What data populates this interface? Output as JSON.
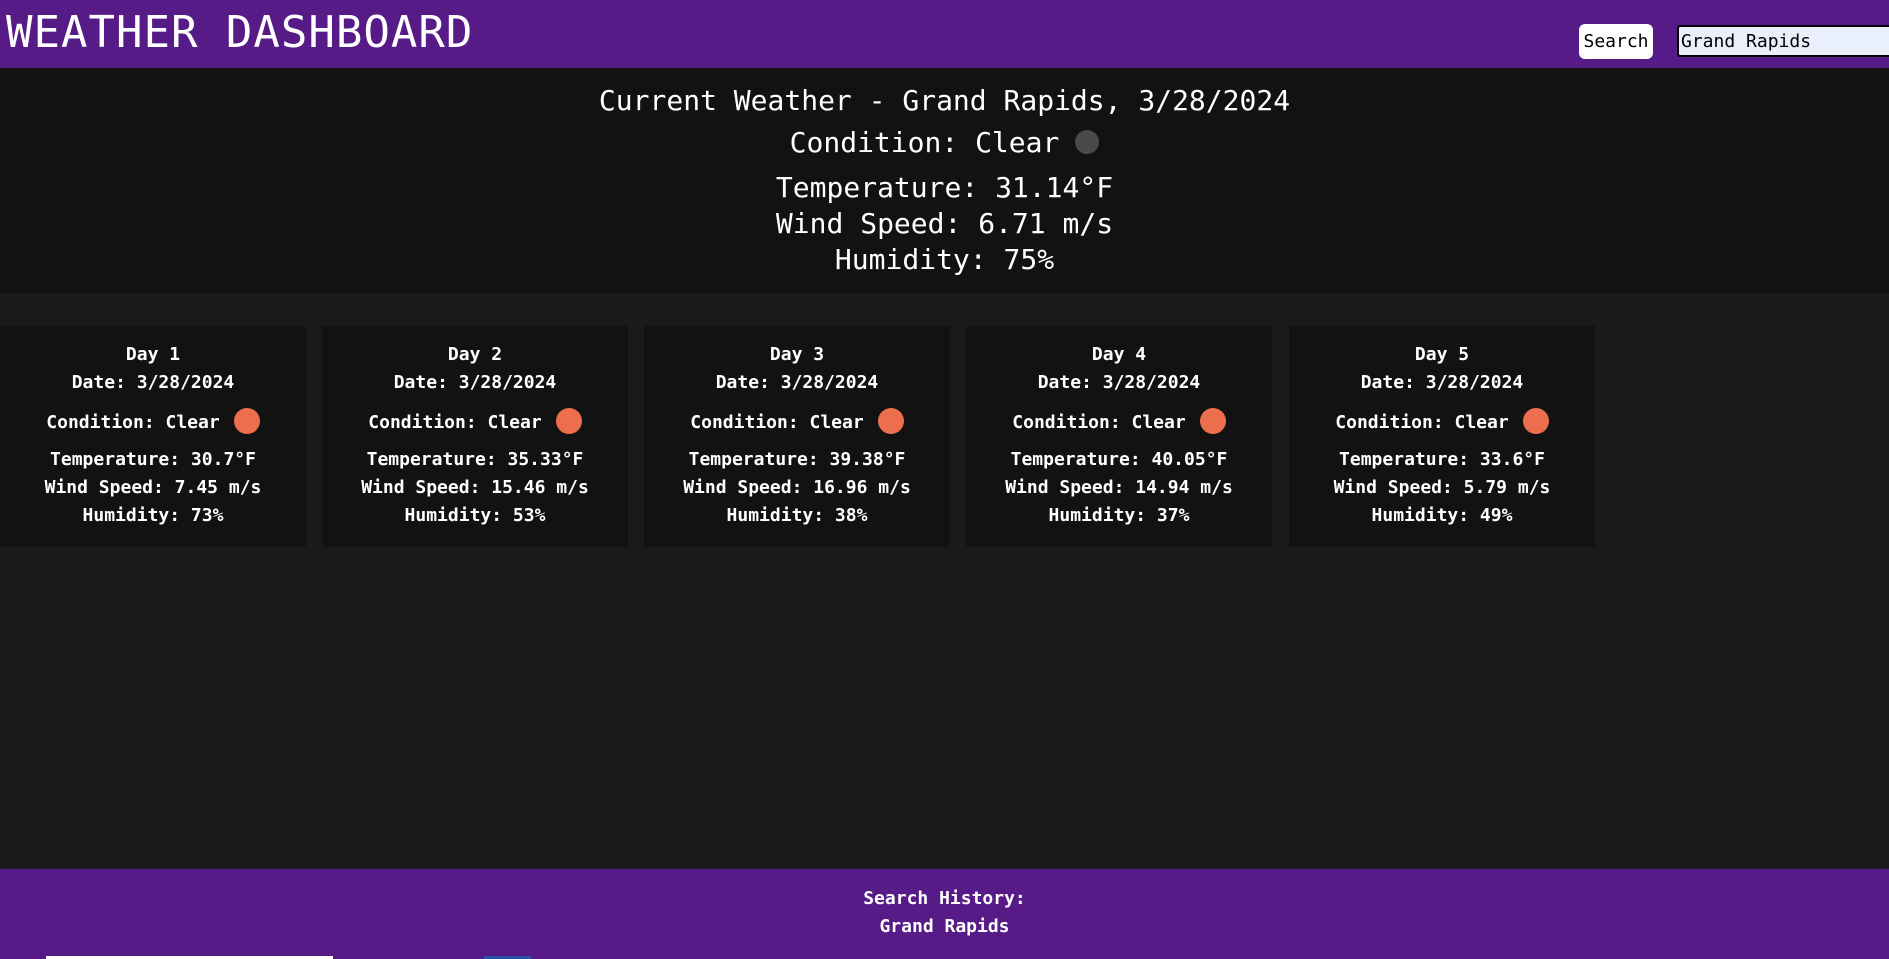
{
  "header": {
    "title": "WEATHER DASHBOARD",
    "search_button": "Search",
    "search_value": "Grand Rapids"
  },
  "current": {
    "title": "Current Weather - Grand Rapids, 3/28/2024",
    "condition": "Condition: Clear",
    "condition_icon": "weather-condition-icon",
    "temperature": "Temperature: 31.14°F",
    "wind": "Wind Speed: 6.71 m/s",
    "humidity": "Humidity: 75%"
  },
  "forecast": [
    {
      "day": "Day 1",
      "date": "Date: 3/28/2024",
      "condition": "Condition: Clear",
      "temperature": "Temperature: 30.7°F",
      "wind": "Wind Speed: 7.45 m/s",
      "humidity": "Humidity: 73%"
    },
    {
      "day": "Day 2",
      "date": "Date: 3/28/2024",
      "condition": "Condition: Clear",
      "temperature": "Temperature: 35.33°F",
      "wind": "Wind Speed: 15.46 m/s",
      "humidity": "Humidity: 53%"
    },
    {
      "day": "Day 3",
      "date": "Date: 3/28/2024",
      "condition": "Condition: Clear",
      "temperature": "Temperature: 39.38°F",
      "wind": "Wind Speed: 16.96 m/s",
      "humidity": "Humidity: 38%"
    },
    {
      "day": "Day 4",
      "date": "Date: 3/28/2024",
      "condition": "Condition: Clear",
      "temperature": "Temperature: 40.05°F",
      "wind": "Wind Speed: 14.94 m/s",
      "humidity": "Humidity: 37%"
    },
    {
      "day": "Day 5",
      "date": "Date: 3/28/2024",
      "condition": "Condition: Clear",
      "temperature": "Temperature: 33.6°F",
      "wind": "Wind Speed: 5.79 m/s",
      "humidity": "Humidity: 49%"
    }
  ],
  "footer": {
    "history_label": "Search History:",
    "history_items": [
      "Grand Rapids"
    ]
  },
  "colors": {
    "header_bg": "#561b86",
    "page_bg": "#1a1a1c",
    "panel_bg": "#121212",
    "sun_icon": "#ec6e4c",
    "current_icon": "#4a4a4a"
  }
}
